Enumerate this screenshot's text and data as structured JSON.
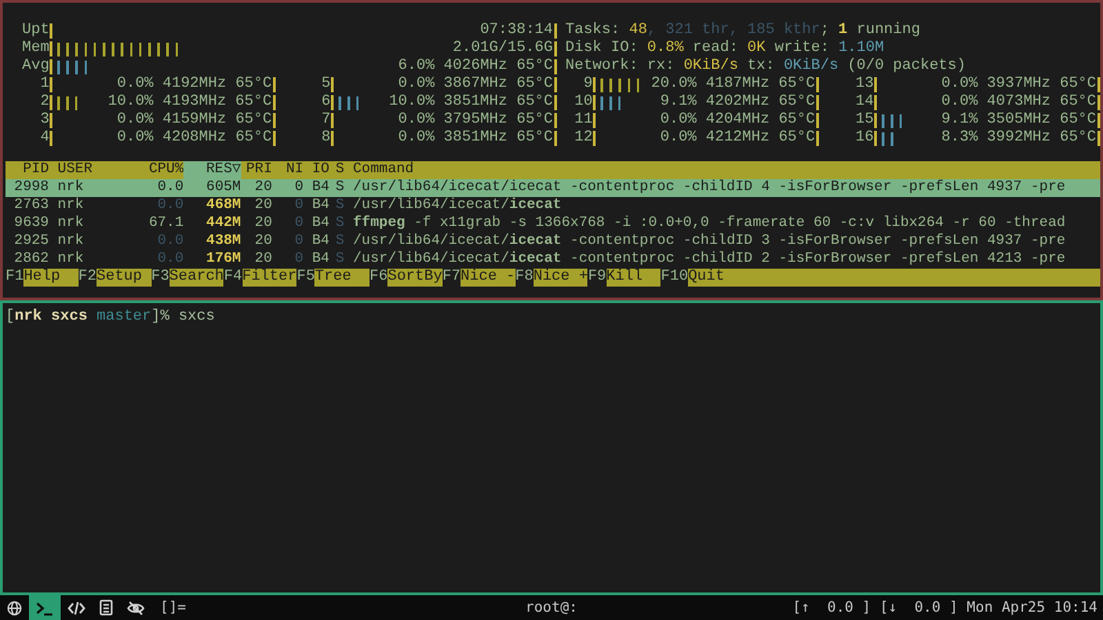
{
  "htop": {
    "left_meters": [
      {
        "label": "Upt",
        "reading": "07:38:14"
      },
      {
        "label": "Mem",
        "reading": "2.01G/15.6G",
        "color": "#a8a42c",
        "level": 0.26
      },
      {
        "label": "Avg",
        "reading": "6.0% 4026MHz 65°C",
        "color": "#4f8ea6",
        "level": 0.08
      }
    ],
    "summary_lines": [
      [
        {
          "text": "Tasks: ",
          "kind": "label"
        },
        {
          "text": "48",
          "kind": "value"
        },
        {
          "text": ", 321 thr, 185 kthr",
          "kind": "dim"
        },
        {
          "text": "; ",
          "kind": "label"
        },
        {
          "text": "1",
          "kind": "strong"
        },
        {
          "text": " running",
          "kind": "label"
        }
      ],
      [
        {
          "text": "Disk IO: ",
          "kind": "label"
        },
        {
          "text": "0.8%",
          "kind": "value"
        },
        {
          "text": " read: ",
          "kind": "label"
        },
        {
          "text": "0K",
          "kind": "value"
        },
        {
          "text": " write: ",
          "kind": "label"
        },
        {
          "text": "1.10M",
          "kind": "info"
        }
      ],
      [
        {
          "text": "Network: rx: ",
          "kind": "label"
        },
        {
          "text": "0KiB/s",
          "kind": "value"
        },
        {
          "text": " tx: ",
          "kind": "label"
        },
        {
          "text": "0KiB/s",
          "kind": "info"
        },
        {
          "text": " (0/0 packets)",
          "kind": "label"
        }
      ]
    ],
    "cpus_left": [
      {
        "label": "1",
        "reading": "0.0% 4192MHz 65°C"
      },
      {
        "label": "2",
        "reading": "10.0% 4193MHz 65°C",
        "color": "#a8a42c",
        "level": 0.11
      },
      {
        "label": "3",
        "reading": "0.0% 4159MHz 65°C"
      },
      {
        "label": "4",
        "reading": "0.0% 4208MHz 65°C"
      },
      {
        "label": "5",
        "reading": "0.0% 3867MHz 65°C"
      },
      {
        "label": "6",
        "reading": "10.0% 3851MHz 65°C",
        "color": "#4f8ea6",
        "level": 0.11
      },
      {
        "label": "7",
        "reading": "0.0% 3795MHz 65°C"
      },
      {
        "label": "8",
        "reading": "0.0% 3851MHz 65°C"
      }
    ],
    "cpus_right": [
      {
        "label": "9",
        "reading": "20.0% 4187MHz 65°C",
        "color": "#a8a42c",
        "level": 0.22
      },
      {
        "label": "10",
        "reading": "9.1% 4202MHz 65°C",
        "color": "#4f8ea6",
        "level": 0.11
      },
      {
        "label": "11",
        "reading": "0.0% 4204MHz 65°C"
      },
      {
        "label": "12",
        "reading": "0.0% 4212MHz 65°C"
      },
      {
        "label": "13",
        "reading": "0.0% 3937MHz 65°C"
      },
      {
        "label": "14",
        "reading": "0.0% 4073MHz 65°C"
      },
      {
        "label": "15",
        "reading": "9.1% 3505MHz 65°C",
        "color": "#4f8ea6",
        "level": 0.11
      },
      {
        "label": "16",
        "reading": "8.3% 3992MHz 65°C",
        "color": "#4f8ea6",
        "level": 0.07
      }
    ],
    "columns": [
      {
        "label": "PID",
        "selected": false
      },
      {
        "label": "USER",
        "selected": false
      },
      {
        "label": "CPU%",
        "selected": false
      },
      {
        "label": "RES▽",
        "selected": true
      },
      {
        "label": "PRI",
        "selected": false
      },
      {
        "label": "NI",
        "selected": false
      },
      {
        "label": "IO",
        "selected": false
      },
      {
        "label": "S",
        "selected": false
      },
      {
        "label": "Command",
        "selected": false
      }
    ],
    "rows": [
      {
        "selected": true,
        "cpu_idle": true,
        "pid": "2998",
        "user": "nrk",
        "cpu": "0.0",
        "res": "605M",
        "pri": "20",
        "ni": "0",
        "io": "B4",
        "s": "S",
        "command": "/usr/lib64/icecat/icecat -contentproc -childID 4 -isForBrowser -prefsLen 4937 -pre"
      },
      {
        "selected": false,
        "cpu_idle": true,
        "pid": "2763",
        "user": "nrk",
        "cpu": "0.0",
        "res": "468M",
        "pri": "20",
        "ni": "0",
        "io": "B4",
        "s": "S",
        "command": "/usr/lib64/icecat/**icecat**"
      },
      {
        "selected": false,
        "cpu_idle": false,
        "pid": "9639",
        "user": "nrk",
        "cpu": "67.1",
        "res": "442M",
        "pri": "20",
        "ni": "0",
        "io": "B4",
        "s": "S",
        "command": "**ffmpeg** -f x11grab -s 1366x768 -i :0.0+0,0 -framerate 60 -c:v libx264 -r 60 -thread"
      },
      {
        "selected": false,
        "cpu_idle": true,
        "pid": "2925",
        "user": "nrk",
        "cpu": "0.0",
        "res": "438M",
        "pri": "20",
        "ni": "0",
        "io": "B4",
        "s": "S",
        "command": "/usr/lib64/icecat/**icecat** -contentproc -childID 3 -isForBrowser -prefsLen 4937 -pre"
      },
      {
        "selected": false,
        "cpu_idle": true,
        "pid": "2862",
        "user": "nrk",
        "cpu": "0.0",
        "res": "176M",
        "pri": "20",
        "ni": "0",
        "io": "B4",
        "s": "S",
        "command": "/usr/lib64/icecat/**icecat** -contentproc -childID 2 -isForBrowser -prefsLen 4213 -pre"
      }
    ],
    "function_keys": [
      {
        "key": "F1",
        "label": "Help"
      },
      {
        "key": "F2",
        "label": "Setup"
      },
      {
        "key": "F3",
        "label": "Search"
      },
      {
        "key": "F4",
        "label": "Filter"
      },
      {
        "key": "F5",
        "label": "Tree"
      },
      {
        "key": "F6",
        "label": "SortBy"
      },
      {
        "key": "F7",
        "label": "Nice -"
      },
      {
        "key": "F8",
        "label": "Nice +"
      },
      {
        "key": "F9",
        "label": "Kill"
      },
      {
        "key": "F10",
        "label": "Quit"
      }
    ]
  },
  "terminal": {
    "prompt": [
      {
        "text": "[",
        "kind": "plain"
      },
      {
        "text": "nrk sxcs",
        "kind": "strong"
      },
      {
        "text": " master",
        "kind": "branch"
      },
      {
        "text": "]% ",
        "kind": "plain"
      },
      {
        "text": "sxcs",
        "kind": "plain"
      }
    ]
  },
  "status_bar": {
    "workspaces": [
      {
        "kind": "globe",
        "selected": false
      },
      {
        "kind": "terminal",
        "selected": true
      },
      {
        "kind": "code",
        "selected": false
      },
      {
        "kind": "document",
        "selected": false
      },
      {
        "kind": "eye-off",
        "selected": false
      }
    ],
    "layout": "[]=",
    "title": "root@:",
    "net_up": "[↑  0.0 ]",
    "net_down": "[↓  0.0 ]",
    "clock": "Mon Apr25 10:14"
  }
}
